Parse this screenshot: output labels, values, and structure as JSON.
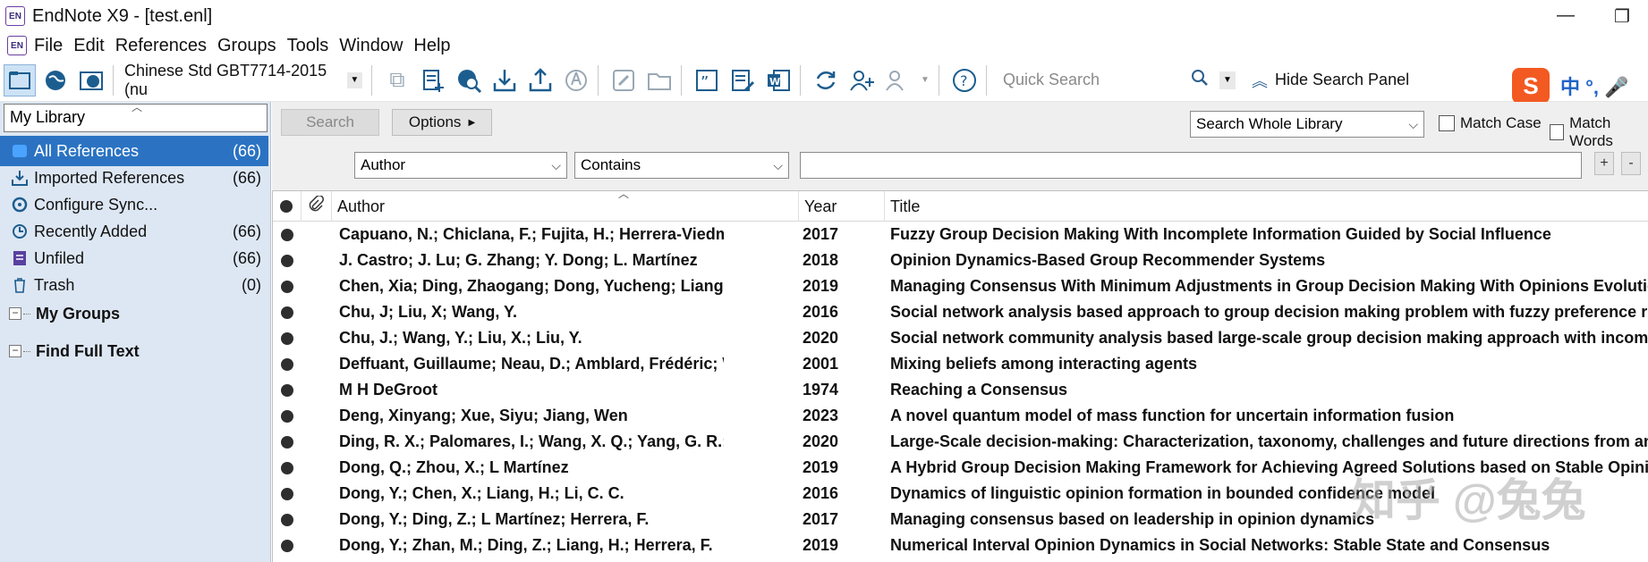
{
  "window": {
    "title": "EndNote X9 - [test.enl]",
    "logo_text": "EN",
    "minimize_glyph": "—",
    "restore_glyph": "❐"
  },
  "menu": [
    "File",
    "Edit",
    "References",
    "Groups",
    "Tools",
    "Window",
    "Help"
  ],
  "toolbar": {
    "style_value": "Chinese Std GBT7714-2015 (nu",
    "quick_search_placeholder": "Quick Search",
    "hide_panel_label": "Hide Search Panel",
    "icons": [
      "local-library-icon",
      "online-search-icon",
      "integrated-library-icon",
      "copy-to-local-icon",
      "new-reference-icon",
      "online-search-mode-icon",
      "import-icon",
      "export-icon",
      "find-full-text-icon",
      "open-link-icon",
      "open-file-icon",
      "insert-citation-icon",
      "format-bibliography-icon",
      "word-icon",
      "sync-icon",
      "share-library-icon",
      "share-group-icon",
      "help-icon"
    ]
  },
  "ime": {
    "logo": "S",
    "text": "中 °, 🎤"
  },
  "sidebar": {
    "library_label": "My Library",
    "groups": [
      {
        "label": "All References",
        "count": "(66)",
        "icon": "all-references-icon",
        "selected": true
      },
      {
        "label": "Imported References",
        "count": "(66)",
        "icon": "imported-references-icon",
        "selected": false
      },
      {
        "label": "Configure Sync...",
        "count": "",
        "icon": "sync-icon",
        "selected": false
      },
      {
        "label": "Recently Added",
        "count": "(66)",
        "icon": "recently-added-icon",
        "selected": false
      },
      {
        "label": "Unfiled",
        "count": "(66)",
        "icon": "unfiled-icon",
        "selected": false
      },
      {
        "label": "Trash",
        "count": "(0)",
        "icon": "trash-icon",
        "selected": false
      }
    ],
    "sections": [
      "My Groups",
      "Find Full Text"
    ]
  },
  "search_panel": {
    "search_button": "Search",
    "options_button": "Options",
    "scope": "Search Whole Library",
    "match_case": "Match Case",
    "match_words": "Match Words",
    "field": "Author",
    "operator": "Contains",
    "text_value": "",
    "plus": "+",
    "minus": "-"
  },
  "table": {
    "headers": {
      "author": "Author",
      "year": "Year",
      "title": "Title"
    },
    "rows": [
      {
        "author": "Capuano, N.; Chiclana, F.; Fujita, H.; Herrera-Viedma, E.; L...",
        "year": "2017",
        "title": "Fuzzy Group Decision Making With Incomplete Information Guided by Social Influence"
      },
      {
        "author": "J. Castro; J. Lu; G. Zhang; Y. Dong; L. Martínez",
        "year": "2018",
        "title": "Opinion Dynamics-Based Group Recommender Systems"
      },
      {
        "author": "Chen, Xia; Ding, Zhaogang; Dong, Yucheng; Liang, Haiming",
        "year": "2019",
        "title": "Managing Consensus With Minimum Adjustments in Group Decision Making With Opinions Evolutio"
      },
      {
        "author": "Chu, J; Liu, X; Wang, Y.",
        "year": "2016",
        "title": "Social network analysis based approach to group decision making problem with fuzzy preference re"
      },
      {
        "author": "Chu, J.; Wang, Y.; Liu, X.; Liu, Y.",
        "year": "2020",
        "title": "Social network community analysis based large-scale group decision making approach with incompl"
      },
      {
        "author": "Deffuant, Guillaume; Neau, D.; Amblard, Frédéric; Weisbu...",
        "year": "2001",
        "title": "Mixing beliefs among interacting agents"
      },
      {
        "author": "M H DeGroot",
        "year": "1974",
        "title": "Reaching a Consensus"
      },
      {
        "author": "Deng, Xinyang; Xue, Siyu; Jiang, Wen",
        "year": "2023",
        "title": "A novel quantum model of mass function for uncertain information fusion"
      },
      {
        "author": "Ding, R. X.; Palomares, I.; Wang, X. Q.; Yang, G. R.; Liu, B. ...",
        "year": "2020",
        "title": "Large-Scale decision-making: Characterization, taxonomy, challenges and future directions from an"
      },
      {
        "author": "Dong, Q.; Zhou, X.; L Martínez",
        "year": "2019",
        "title": "A Hybrid Group Decision Making Framework for Achieving Agreed Solutions based on Stable Opinio"
      },
      {
        "author": "Dong, Y.; Chen, X.; Liang, H.; Li, C. C.",
        "year": "2016",
        "title": "Dynamics of linguistic opinion formation in bounded confidence model"
      },
      {
        "author": "Dong, Y.; Ding, Z.; L Martínez; Herrera, F.",
        "year": "2017",
        "title": "Managing consensus based on leadership in opinion dynamics"
      },
      {
        "author": "Dong, Y.; Zhan, M.; Ding, Z.; Liang, H.; Herrera, F.",
        "year": "2019",
        "title": "Numerical Interval Opinion Dynamics in Social Networks: Stable State and Consensus"
      }
    ]
  },
  "watermark": "知乎 @兔兔",
  "colors": {
    "selection": "#2b73c2",
    "sidebar_bg": "#dde7f3",
    "accent": "#1c5d8f"
  }
}
